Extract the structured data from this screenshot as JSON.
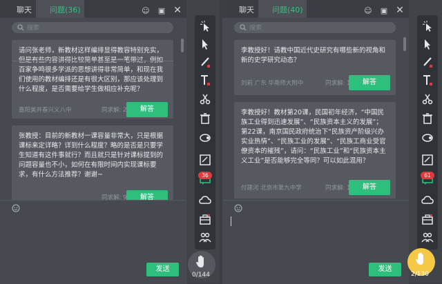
{
  "colors": {
    "accent": "#2fbf7c",
    "badge": "#e0393f",
    "hand_active": "#f5c945"
  },
  "left": {
    "tab_chat": "聊天",
    "tab_questions": "问题(36)",
    "search_placeholder": "搜索",
    "questions": [
      {
        "text": "请问张老师，新教材这样编排显得教容特别充实，但是有些内容讲得比较简单甚至是一笔带过，例如百家争鸣很多学派的思想讲得非常简单，和现在我们使用的教材编排还是有很大区别，那应该处理到什么程度，是否需要给学生做相应补充呢？",
        "author": "嘉阳美并春兴义八中",
        "count_label": "同求解: 22",
        "answer_label": "解答"
      },
      {
        "text": "张教授：目前的新教材一课容量非常大，只是根据课标来定详略？详到什么程度？略的是否是只要学生知道有这件事就行？而且就只是针对课标提到的问题容量也不小，如何在有限时间内实现课标要求，有什么方法推荐？谢谢~",
        "author": "",
        "count_label": "同求解: 9",
        "answer_label": "解答"
      }
    ],
    "send_label": "发送",
    "hand_count": "0/144",
    "badge_count": "36"
  },
  "right": {
    "tab_chat": "聊天",
    "tab_questions": "问题(40)",
    "search_placeholder": "搜索",
    "questions": [
      {
        "text": "李教授好！请教中国近代史研究有哪些新的视角和新的史学研究动态？",
        "author": "刘莉  广东 华南师大附中",
        "count_label": "同求解: 18",
        "answer_label": "解答"
      },
      {
        "text": "李教授好！教材第20课，民国初年经济，“中国民族工业得到迅速发展”、“民族资本主义的发展”；第22课，南京国民政府统治下“民族资产阶级兴办实业热情”、“民族工业的发展”、“民族工商业受官僚资本的摧残”，请问：“民族工业”和“民族资本主义工业”是否能够完全等同？可以如此混用？",
        "author": "付建河  北京市第九中学",
        "count_label": "同求解: 12",
        "answer_label": "解答"
      }
    ],
    "send_label": "发送",
    "hand_count": "2/130",
    "badge_count": "61"
  },
  "icons": [
    "laser-pointer-icon",
    "pointer-icon",
    "pen-icon",
    "text-icon",
    "scissors-icon",
    "trash-icon",
    "eraser-icon",
    "board-icon",
    "chat-icon",
    "cloud-icon",
    "toolbox-icon",
    "users-icon"
  ]
}
